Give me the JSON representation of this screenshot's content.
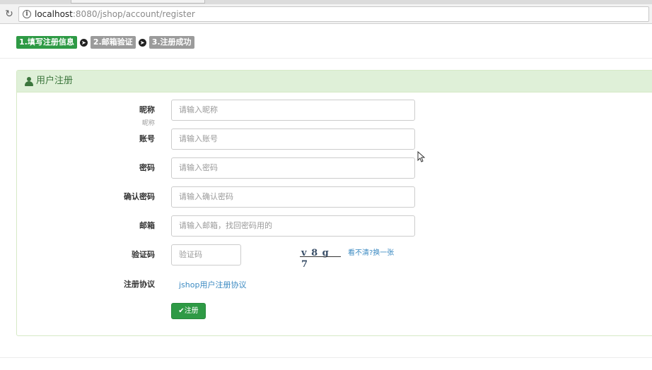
{
  "browser": {
    "url_host": "localhost",
    "url_rest": ":8080/jshop/account/register"
  },
  "steps": [
    {
      "label": "1.填写注册信息",
      "state": "active"
    },
    {
      "label": "2.邮箱验证",
      "state": "inactive"
    },
    {
      "label": "3.注册成功",
      "state": "inactive"
    }
  ],
  "panel": {
    "title": "用户注册"
  },
  "form": {
    "nickname": {
      "label": "昵称",
      "ghost": "昵称",
      "placeholder": "请输入昵称"
    },
    "account": {
      "label": "账号",
      "placeholder": "请输入账号"
    },
    "password": {
      "label": "密码",
      "placeholder": "请输入密码"
    },
    "confirm_password": {
      "label": "确认密码",
      "placeholder": "请输入确认密码"
    },
    "email": {
      "label": "邮箱",
      "placeholder": "请输入邮箱，找回密码用的"
    },
    "captcha": {
      "label": "验证码",
      "placeholder": "验证码",
      "image_text": "v 8 g 7",
      "refresh_label": "看不清?换一张"
    },
    "agreement": {
      "label": "注册协议",
      "link_text": "jshop用户注册协议"
    },
    "submit_label": "注册"
  },
  "colors": {
    "primary_green": "#2e9a45",
    "inactive_gray": "#9b9b9b",
    "panel_heading_bg": "#dff0d8",
    "panel_title": "#3c763d",
    "link_blue": "#3b8ac2"
  }
}
